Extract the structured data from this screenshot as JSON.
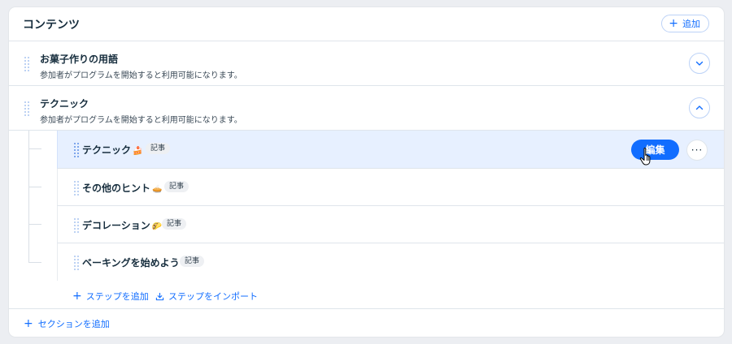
{
  "header": {
    "title": "コンテンツ",
    "add_label": "追加"
  },
  "sections": [
    {
      "title": "お菓子作りの用語",
      "description": "参加者がプログラムを開始すると利用可能になります。",
      "toggle_icon": "chevron-down-icon"
    },
    {
      "title": "テクニック",
      "description": "参加者がプログラムを開始すると利用可能になります。",
      "toggle_icon": "chevron-up-icon"
    }
  ],
  "steps": [
    {
      "title": "テクニック",
      "emoji": "🍰",
      "badge": "記事"
    },
    {
      "title": "その他のヒント",
      "emoji": "🥧",
      "badge": "記事"
    },
    {
      "title": "デコレーション",
      "emoji": "🌮",
      "badge": "記事"
    },
    {
      "title": "ベーキングを始めよう",
      "emoji": "",
      "badge": "記事"
    }
  ],
  "step_actions": {
    "edit_label": "編集",
    "more_label": "···"
  },
  "links": {
    "add_step": "ステップを追加",
    "import_step": "ステップをインポート",
    "add_section": "セクションを追加"
  },
  "colors": {
    "accent": "#116dff",
    "active_row": "#e7f0ff",
    "background": "#eceef2"
  }
}
